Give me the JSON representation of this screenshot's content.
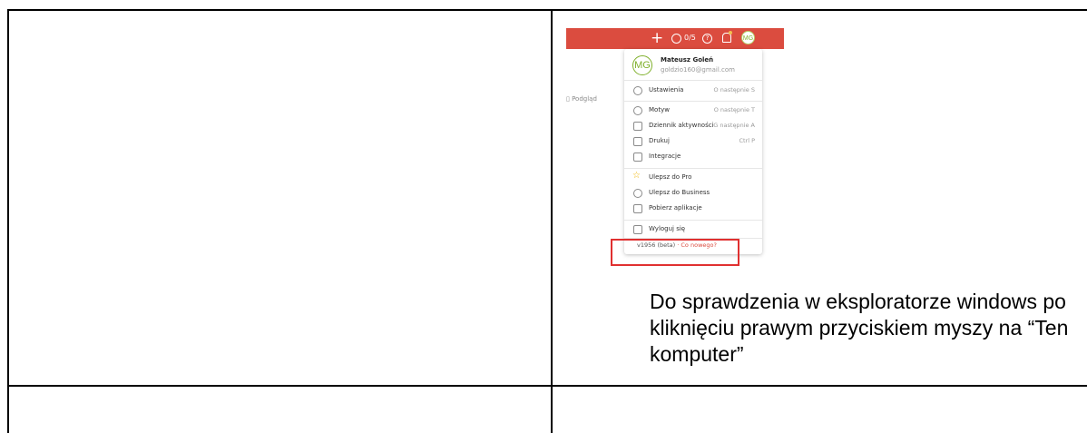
{
  "topbar": {
    "add_icon": "+",
    "karma": "0/5",
    "help_icon": "?",
    "avatar_initials": "MG"
  },
  "sidebar": {
    "preview_label": "Podgląd"
  },
  "menu": {
    "user_name": "Mateusz Goleń",
    "user_email": "goldzio160@gmail.com",
    "avatar_initials": "MG",
    "items": [
      {
        "icon": "gear-icon",
        "label": "Ustawienia",
        "shortcut": "O następnie S"
      },
      {
        "icon": "palette-icon",
        "label": "Motyw",
        "shortcut": "O następnie T"
      },
      {
        "icon": "activity-icon",
        "label": "Dziennik aktywności",
        "shortcut": "G następnie A"
      },
      {
        "icon": "printer-icon",
        "label": "Drukuj",
        "shortcut": "Ctrl P"
      },
      {
        "icon": "integrations-icon",
        "label": "Integracje",
        "shortcut": ""
      },
      {
        "icon": "star-icon",
        "label": "Ulepsz do Pro",
        "shortcut": ""
      },
      {
        "icon": "users-icon",
        "label": "Ulepsz do Business",
        "shortcut": ""
      },
      {
        "icon": "phone-icon",
        "label": "Pobierz aplikacje",
        "shortcut": ""
      },
      {
        "icon": "logout-icon",
        "label": "Wyloguj się",
        "shortcut": ""
      }
    ],
    "version": "v1956 (beta)",
    "whats_new": "· Co nowego?"
  },
  "note": "Do sprawdzenia w eksploratorze windows  po kliknięciu prawym przyciskiem myszy na “Ten komputer”",
  "colors": {
    "brand": "#db4c3f",
    "highlight_box": "#e03030",
    "avatar": "#7fb02b"
  }
}
